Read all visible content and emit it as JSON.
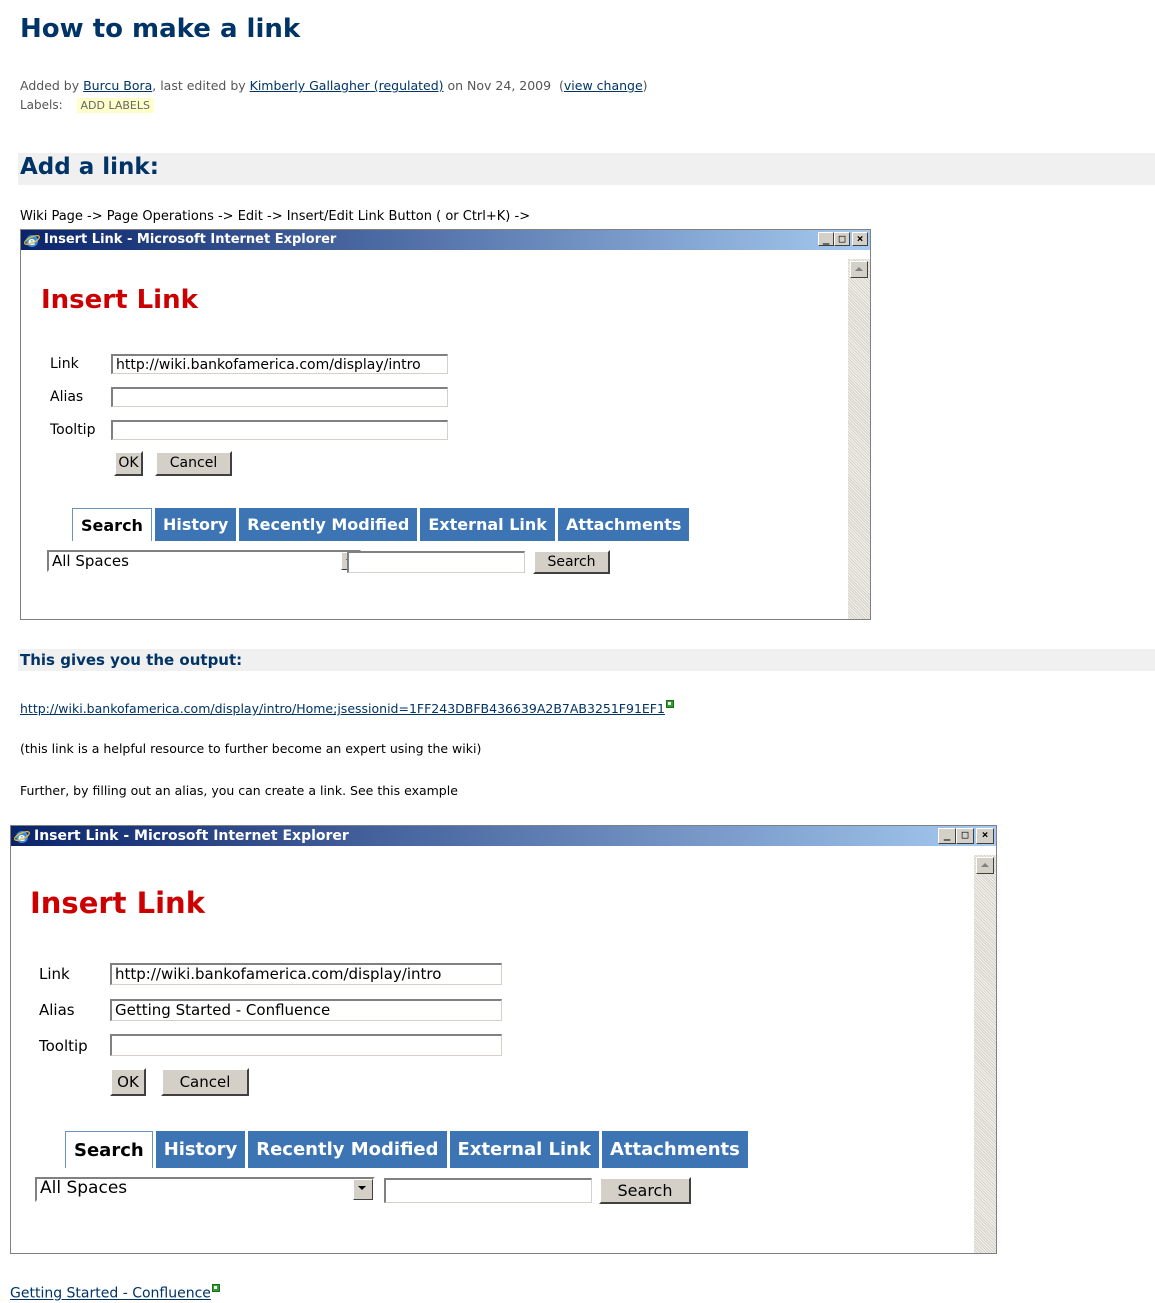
{
  "page": {
    "title": "How to make a link",
    "meta": {
      "added_by_prefix": "Added by ",
      "added_by": "Burcu Bora",
      "edited_prefix": ", last edited by ",
      "edited_by": "Kimberly Gallagher (regulated)",
      "date": " on Nov 24, 2009  (",
      "view_change": "view change",
      "close_paren": ")"
    },
    "labels_prefix": "Labels:",
    "add_labels": "ADD LABELS"
  },
  "section1": {
    "heading": "Add a link:",
    "path": "Wiki Page -> Page Operations -> Edit -> Insert/Edit Link Button ( or Ctrl+K) ->"
  },
  "dialog1": {
    "window_title": "Insert Link - Microsoft Internet Explorer",
    "heading": "Insert Link",
    "link_label": "Link",
    "link_value": "http://wiki.bankofamerica.com/display/intro",
    "alias_label": "Alias",
    "alias_value": "",
    "tooltip_label": "Tooltip",
    "tooltip_value": "",
    "ok": "OK",
    "cancel": "Cancel",
    "tabs": [
      "Search",
      "History",
      "Recently Modified",
      "External Link",
      "Attachments"
    ],
    "space_select": "All Spaces",
    "search_value": "",
    "search_button": "Search"
  },
  "section2": {
    "heading": "This gives you the output:",
    "output_link": "http://wiki.bankofamerica.com/display/intro/Home;jsessionid=1FF243DBFB436639A2B7AB3251F91EF1",
    "note": "(this link is a helpful resource to further become an expert using the wiki)",
    "further": "Further, by filling out an alias, you can create a link. See this example"
  },
  "dialog2": {
    "window_title": "Insert Link - Microsoft Internet Explorer",
    "heading": "Insert Link",
    "link_label": "Link",
    "link_value": "http://wiki.bankofamerica.com/display/intro",
    "alias_label": "Alias",
    "alias_value": "Getting Started - Confluence",
    "tooltip_label": "Tooltip",
    "tooltip_value": "",
    "ok": "OK",
    "cancel": "Cancel",
    "tabs": [
      "Search",
      "History",
      "Recently Modified",
      "External Link",
      "Attachments"
    ],
    "space_select": "All Spaces",
    "search_value": "",
    "search_button": "Search"
  },
  "final_link": "Getting Started - Confluence",
  "colors": {
    "heading": "#003366",
    "dialog_heading": "#cc0000",
    "tab": "#3c74b4",
    "label_bg": "#ffffcc"
  }
}
